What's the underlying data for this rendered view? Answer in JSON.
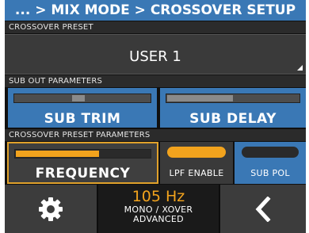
{
  "header": {
    "breadcrumb": "... > MIX MODE > CROSSOVER SETUP"
  },
  "crossover_preset": {
    "section_label": "CROSSOVER PRESET",
    "value": "USER 1"
  },
  "sub_out": {
    "section_label": "SUB OUT PARAMETERS",
    "trim": {
      "label": "SUB TRIM",
      "level": 0.47
    },
    "delay": {
      "label": "SUB DELAY",
      "level": 0.5
    }
  },
  "crossover_params": {
    "section_label": "CROSSOVER PRESET PARAMETERS",
    "frequency": {
      "label": "FREQUENCY",
      "level": 0.62
    },
    "lpf_enable": {
      "label": "LPF ENABLE",
      "state": "on"
    },
    "sub_pol": {
      "label": "SUB POL",
      "state": "off"
    }
  },
  "footer": {
    "settings_icon": "gear-icon",
    "back_icon": "chevron-left-icon",
    "frequency_value": "105 Hz",
    "mode_line1": "MONO / XOVER",
    "mode_line2": "ADVANCED"
  },
  "colors": {
    "accent_blue": "#3a78b5",
    "accent_orange": "#f2a31d",
    "panel_dark": "#3a3a3a",
    "background": "#101010"
  }
}
